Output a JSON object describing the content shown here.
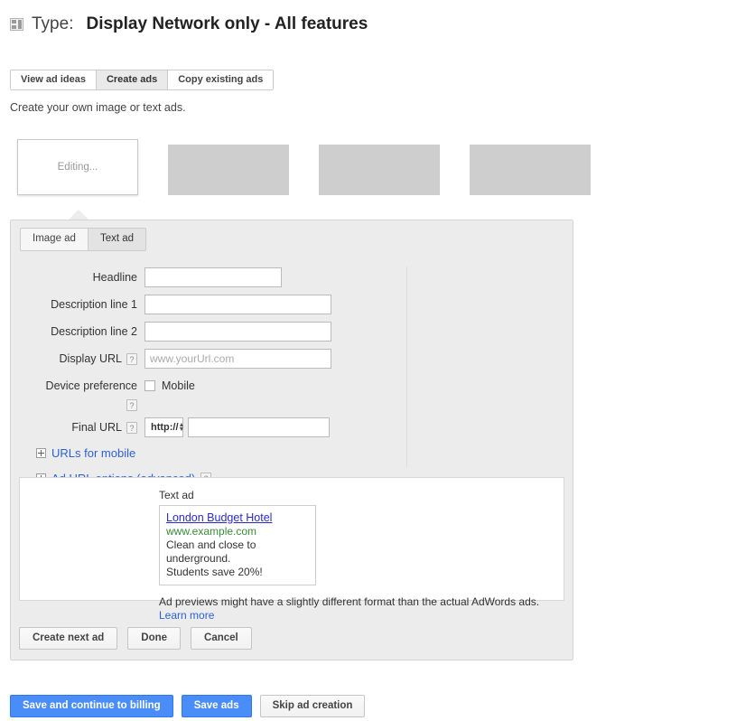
{
  "header": {
    "icon": "campaign-type-icon",
    "label": "Type:",
    "value": "Display Network only - All features"
  },
  "tabs": [
    {
      "label": "View ad ideas",
      "selected": false
    },
    {
      "label": "Create ads",
      "selected": true
    },
    {
      "label": "Copy existing ads",
      "selected": false
    }
  ],
  "subtitle": "Create your own image or text ads.",
  "thumbnails": [
    {
      "label": "Editing...",
      "state": "editing"
    },
    {
      "label": "",
      "state": "placeholder"
    },
    {
      "label": "",
      "state": "placeholder"
    },
    {
      "label": "",
      "state": "placeholder"
    }
  ],
  "editor": {
    "inner_tabs": [
      {
        "label": "Image ad",
        "selected": false
      },
      {
        "label": "Text ad",
        "selected": true
      }
    ],
    "fields": {
      "headline": {
        "label": "Headline",
        "value": "",
        "placeholder": ""
      },
      "description_line_1": {
        "label": "Description line 1",
        "value": "",
        "placeholder": ""
      },
      "description_line_2": {
        "label": "Description line 2",
        "value": "",
        "placeholder": ""
      },
      "display_url": {
        "label": "Display URL",
        "value": "",
        "placeholder": "www.yourUrl.com",
        "help": "?"
      },
      "device_preference": {
        "label": "Device preference",
        "checkbox_label": "Mobile",
        "checked": false,
        "help": "?"
      },
      "final_url": {
        "label": "Final URL",
        "value": "",
        "placeholder": "",
        "help": "?",
        "protocol": "http://"
      }
    },
    "expandables": [
      {
        "label": "URLs for mobile",
        "has_help": false
      },
      {
        "label": "Ad URL options (advanced)",
        "has_help": true,
        "help": "?"
      }
    ],
    "preview": {
      "caption": "Text ad",
      "ad_title": "London Budget Hotel",
      "ad_url": "www.example.com",
      "ad_line_1": "Clean and close to underground.",
      "ad_line_2": "Students save 20%!",
      "note": "Ad previews might have a slightly different format than the actual AdWords ads.",
      "learn_more": "Learn more"
    },
    "actions": [
      {
        "label": "Create next ad"
      },
      {
        "label": "Done"
      },
      {
        "label": "Cancel"
      }
    ]
  },
  "bottom_actions": [
    {
      "label": "Save and continue to billing",
      "style": "primary"
    },
    {
      "label": "Save ads",
      "style": "primary"
    },
    {
      "label": "Skip ad creation",
      "style": "secondary"
    }
  ],
  "colors": {
    "primary_button": "#4b8df8",
    "link": "#2a62d6",
    "panel_bg": "#ececec",
    "thumb_placeholder": "#cecece",
    "ad_title": "#2b2bcb",
    "ad_url": "#3a8a3a"
  }
}
